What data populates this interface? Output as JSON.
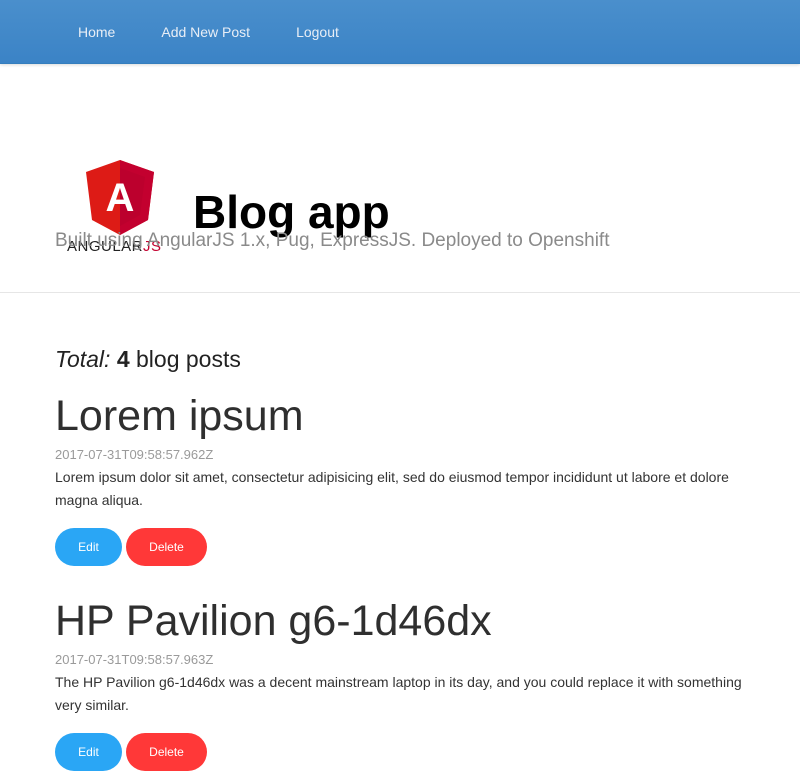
{
  "nav": {
    "items": [
      {
        "label": "Home"
      },
      {
        "label": "Add New Post"
      },
      {
        "label": "Logout"
      }
    ]
  },
  "hero": {
    "logo_text_main": "ANGULAR",
    "logo_text_js": "JS",
    "logo_letter": "A",
    "title": "Blog app",
    "subtitle": "Built using AngularJS 1.x, Pug, ExpressJS. Deployed to Openshift"
  },
  "summary": {
    "total_label": "Total:",
    "count": "4",
    "suffix": "blog posts"
  },
  "posts": [
    {
      "title": "Lorem ipsum",
      "date": "2017-07-31T09:58:57.962Z",
      "body": "Lorem ipsum dolor sit amet, consectetur adipisicing elit, sed do eiusmod tempor incididunt ut labore et dolore magna aliqua.",
      "edit_label": "Edit",
      "delete_label": "Delete"
    },
    {
      "title": "HP Pavilion g6-1d46dx",
      "date": "2017-07-31T09:58:57.963Z",
      "body": "The HP Pavilion g6-1d46dx was a decent mainstream laptop in its day, and you could replace it with something very similar.",
      "edit_label": "Edit",
      "delete_label": "Delete"
    }
  ],
  "colors": {
    "navbar": "#428bca",
    "edit_button": "#2aa6f5",
    "delete_button": "#ff3838",
    "angular_red": "#dd1b16"
  }
}
